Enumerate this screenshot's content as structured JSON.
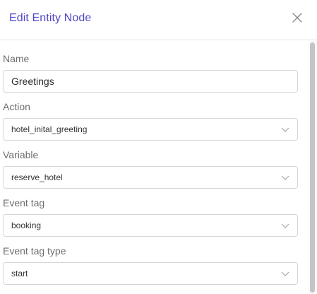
{
  "dialog": {
    "title": "Edit Entity Node",
    "close_icon": "close-icon"
  },
  "form": {
    "name": {
      "label": "Name",
      "value": "Greetings"
    },
    "action": {
      "label": "Action",
      "value": "hotel_inital_greeting"
    },
    "variable": {
      "label": "Variable",
      "value": "reserve_hotel"
    },
    "event_tag": {
      "label": "Event tag",
      "value": "booking"
    },
    "event_tag_type": {
      "label": "Event tag type",
      "value": "start"
    }
  },
  "colors": {
    "title": "#4f46c8",
    "label": "#6e6e6e",
    "border": "#d6d6d6",
    "scrollbar_thumb": "#c4c4c4"
  }
}
